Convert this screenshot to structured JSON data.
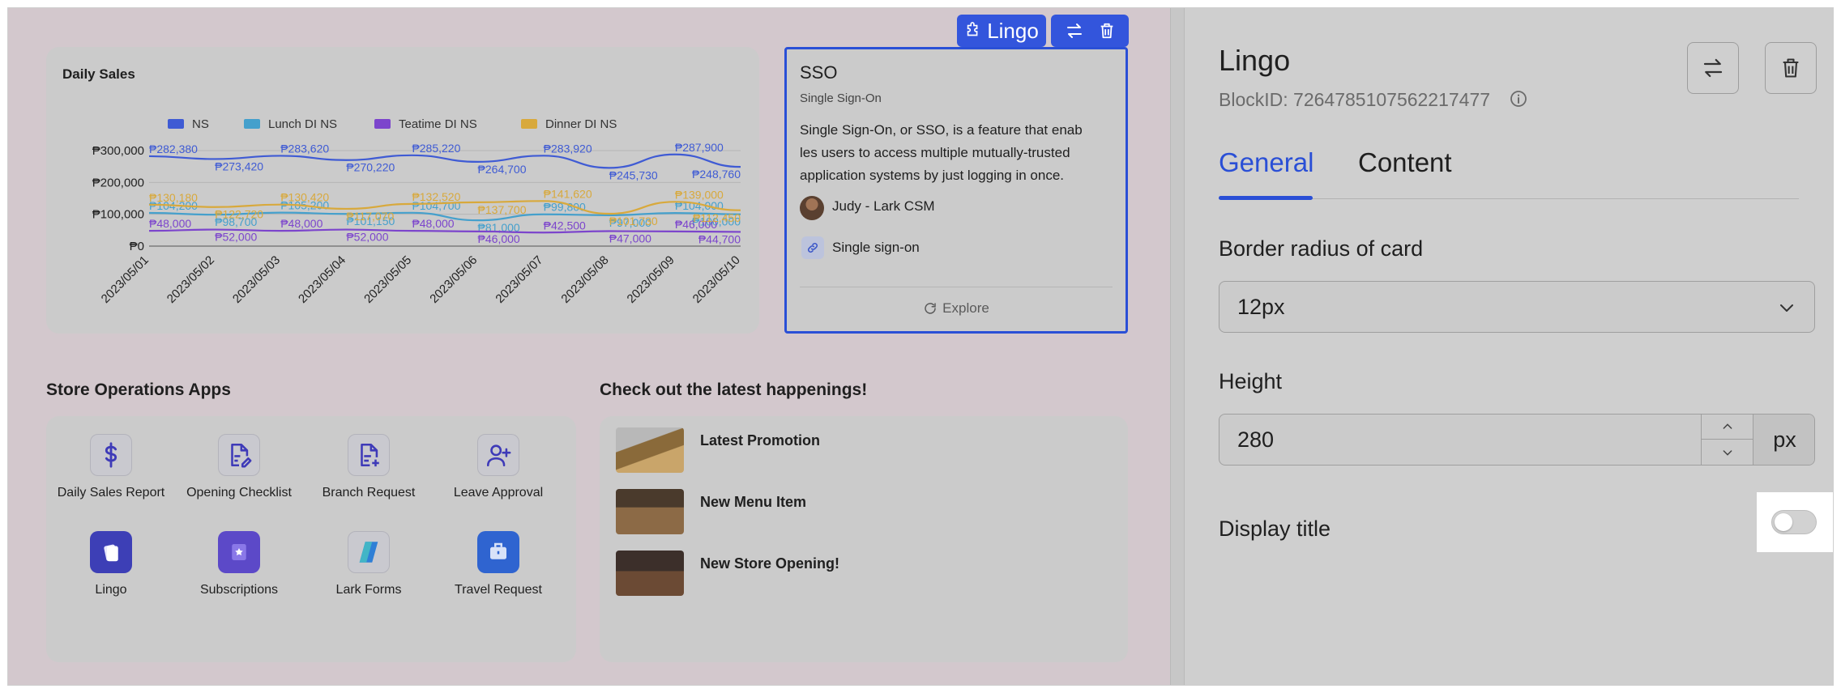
{
  "chart_data": {
    "type": "line",
    "title": "Daily Sales",
    "categories": [
      "2023/05/01",
      "2023/05/02",
      "2023/05/03",
      "2023/05/04",
      "2023/05/05",
      "2023/05/06",
      "2023/05/07",
      "2023/05/08",
      "2023/05/09",
      "2023/05/10"
    ],
    "y_ticks": [
      "₱300,000",
      "₱200,000",
      "₱100,000",
      "₱0"
    ],
    "ylim": [
      0,
      300000
    ],
    "legend_position": "top",
    "grid": true,
    "series": [
      {
        "name": "NS",
        "color": "#3f5bd4",
        "values": [
          282380,
          273420,
          283620,
          270220,
          285220,
          264700,
          283920,
          245730,
          287900,
          248760
        ],
        "labels": [
          "₱282,380",
          "₱273,420",
          "₱283,620",
          "₱270,220",
          "₱285,220",
          "₱264,700",
          "₱283,920",
          "₱245,730",
          "₱287,900",
          "₱248,760"
        ]
      },
      {
        "name": "Lunch DI NS",
        "color": "#45a0cc",
        "values": [
          104200,
          98700,
          105200,
          101150,
          104700,
          81000,
          99800,
          97000,
          104000,
          100000
        ],
        "labels": [
          "₱104,200",
          "₱98,700",
          "₱105,200",
          "₱101,150",
          "₱104,700",
          "₱81,000",
          "₱99,800",
          "₱97,000",
          "₱104,000",
          "₱100,000"
        ]
      },
      {
        "name": "Teatime DI NS",
        "color": "#7c45cc",
        "values": [
          48000,
          52000,
          48000,
          52000,
          48000,
          46000,
          42500,
          47000,
          46000,
          44700
        ],
        "labels": [
          "₱48,000",
          "₱52,000",
          "₱48,000",
          "₱52,000",
          "₱48,000",
          "₱46,000",
          "₱42,500",
          "₱47,000",
          "₱46,000",
          "₱44,700"
        ]
      },
      {
        "name": "Dinner DI NS",
        "color": "#d8a93c",
        "values": [
          130180,
          122720,
          130420,
          117070,
          132520,
          137700,
          141620,
          101730,
          139000,
          112450
        ],
        "labels": [
          "₱130,180",
          "₱122,720",
          "₱130,420",
          "₱117,070",
          "₱132,520",
          "₱137,700",
          "₱141,620",
          "₱101,730",
          "₱139,000",
          "₱112,450"
        ]
      }
    ]
  },
  "toolbar": {
    "block_name": "Lingo"
  },
  "sso": {
    "title": "SSO",
    "subtitle": "Single Sign-On",
    "description_line1": "Single Sign-On, or SSO, is a feature that enab",
    "description_line2": "les users to access multiple mutually-trusted",
    "description_line3": "application systems by just logging in once.",
    "author": "Judy - Lark CSM",
    "link": "Single sign-on",
    "explore": "Explore"
  },
  "apps": {
    "title": "Store Operations Apps",
    "items": [
      {
        "label": "Daily Sales Report",
        "icon": "dollar-icon"
      },
      {
        "label": "Opening Checklist",
        "icon": "checklist-icon"
      },
      {
        "label": "Branch Request",
        "icon": "document-add-icon"
      },
      {
        "label": "Leave Approval",
        "icon": "user-add-icon"
      },
      {
        "label": "Lingo",
        "icon": "lingo-icon"
      },
      {
        "label": "Subscriptions",
        "icon": "subscriptions-icon"
      },
      {
        "label": "Lark Forms",
        "icon": "forms-icon"
      },
      {
        "label": "Travel Request",
        "icon": "suitcase-icon"
      }
    ]
  },
  "news": {
    "title": "Check out the latest happenings!",
    "items": [
      {
        "title": "Latest Promotion"
      },
      {
        "title": "New Menu Item"
      },
      {
        "title": "New Store Opening!"
      }
    ]
  },
  "panel": {
    "title": "Lingo",
    "block_id": "BlockID: 7264785107562217477",
    "tabs": [
      {
        "label": "General"
      },
      {
        "label": "Content"
      }
    ],
    "border_radius_label": "Border radius of card",
    "border_radius_value": "12px",
    "height_label": "Height",
    "height_value": "280",
    "height_unit": "px",
    "display_title_label": "Display title",
    "display_title_enabled": false,
    "accent": "#2a4fd6"
  }
}
